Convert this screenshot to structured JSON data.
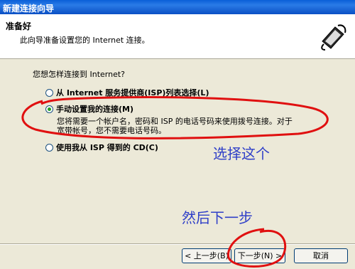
{
  "window": {
    "title": "新建连接向导"
  },
  "header": {
    "title": "准备好",
    "subtitle": "此向导准备设置您的 Internet 连接。",
    "icon": "phone-connection-icon"
  },
  "content": {
    "question": "您想怎样连接到 Internet?",
    "options": [
      {
        "label": "从 Internet 服务提供商(ISP)列表选择(L)",
        "checked": false
      },
      {
        "label": "手动设置我的连接(M)",
        "checked": true
      },
      {
        "label": "使用我从 ISP 得到的 CD(C)",
        "checked": false
      }
    ],
    "description_line1": "您将需要一个帐户名，密码和 ISP 的电话号码来使用拨号连接。对于",
    "description_line2": "宽带帐号，您不需要电话号码。"
  },
  "buttons": {
    "back": "< 上一步(B)",
    "next": "下一步(N) >",
    "cancel": "取消"
  },
  "annotations": {
    "select_this": "选择这个",
    "then_next": "然后下一步",
    "color": "#2f3fc8",
    "circle_color": "#e01010"
  }
}
